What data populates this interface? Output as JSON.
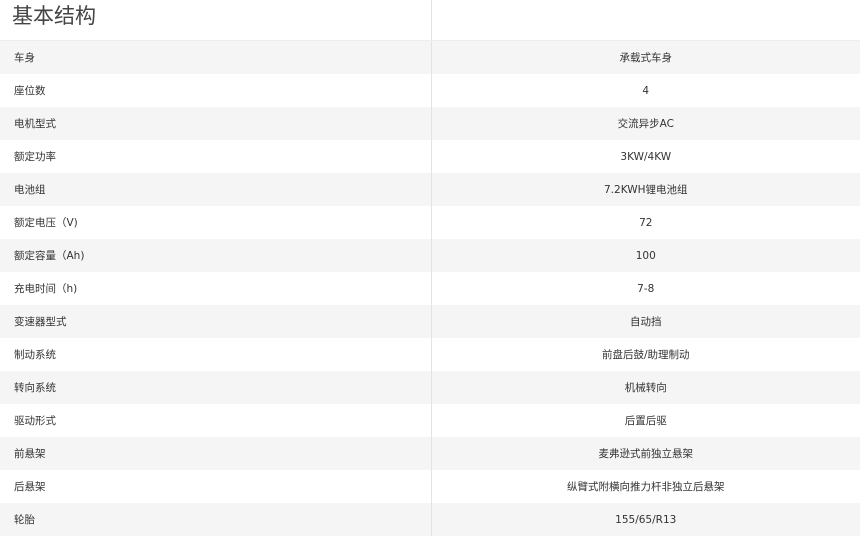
{
  "section": {
    "title": "基本结构"
  },
  "rows": [
    {
      "label": "车身",
      "value": "承载式车身"
    },
    {
      "label": "座位数",
      "value": "4"
    },
    {
      "label": "电机型式",
      "value": "交流异步AC"
    },
    {
      "label": "额定功率",
      "value": "3KW/4KW"
    },
    {
      "label": "电池组",
      "value": "7.2KWH锂电池组"
    },
    {
      "label": "额定电压（V)",
      "value": "72"
    },
    {
      "label": "额定容量（Ah)",
      "value": "100"
    },
    {
      "label": "充电时间（h)",
      "value": "7-8"
    },
    {
      "label": "变速器型式",
      "value": "自动挡"
    },
    {
      "label": "制动系统",
      "value": "前盘后鼓/助理制动"
    },
    {
      "label": "转向系统",
      "value": "机械转向"
    },
    {
      "label": "驱动形式",
      "value": "后置后驱"
    },
    {
      "label": "前悬架",
      "value": "麦弗逊式前独立悬架"
    },
    {
      "label": "后悬架",
      "value": "纵臂式附横向推力杆非独立后悬架"
    },
    {
      "label": "轮胎",
      "value": "155/65/R13"
    }
  ]
}
